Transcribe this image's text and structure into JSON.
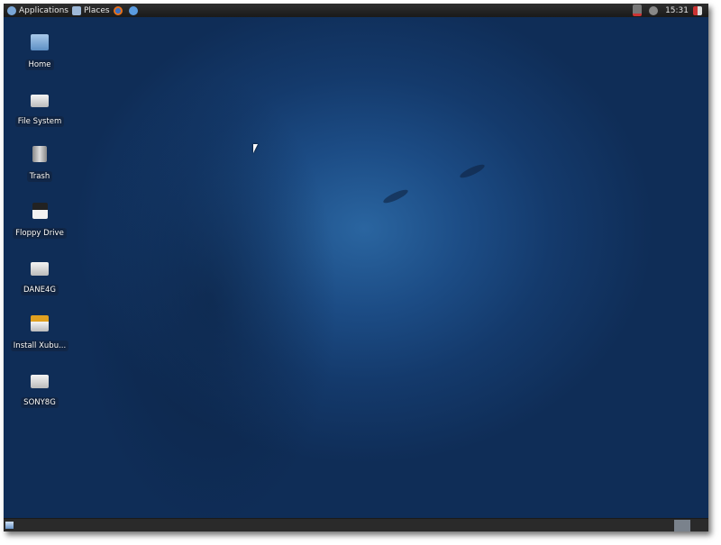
{
  "top_panel": {
    "applications_label": "Applications",
    "places_label": "Places",
    "clock": "15:31"
  },
  "desktop_icons": [
    {
      "label": "Home",
      "icon": "home-folder-icon"
    },
    {
      "label": "File System",
      "icon": "drive-icon"
    },
    {
      "label": "Trash",
      "icon": "trash-icon"
    },
    {
      "label": "Floppy Drive",
      "icon": "floppy-icon"
    },
    {
      "label": "DANE4G",
      "icon": "usb-drive-icon"
    },
    {
      "label": "Install Xubu...",
      "icon": "installer-icon"
    },
    {
      "label": "SONY8G",
      "icon": "usb-drive-icon"
    }
  ],
  "colors": {
    "desktop": "#1c4c85",
    "panel": "#222222"
  }
}
